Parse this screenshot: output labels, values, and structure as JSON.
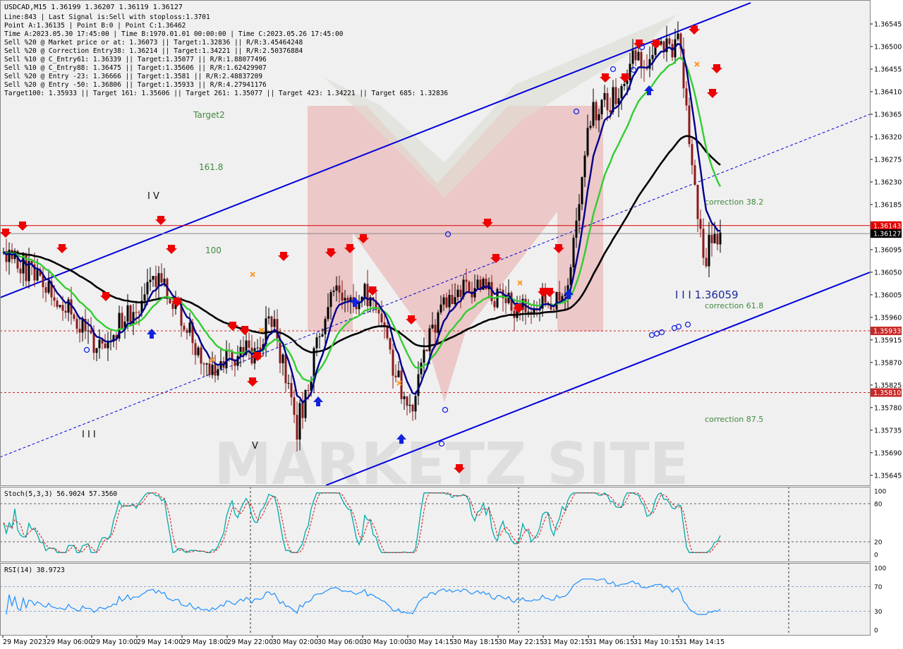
{
  "header": {
    "symbol_line": "USDCAD,M15  1.36199 1.36207 1.36119 1.36127",
    "lines": [
      "Line:843 | Last Signal is:Sell with stoploss:1.3701",
      "Point A:1.36135 | Point B:0 | Point C:1.36462",
      "Time A:2023.05.30 17:45:00 | Time B:1970.01.01 00:00:00 | Time C:2023.05.26 17:45:00",
      "Sell %20 @ Market price or at: 1.36073 || Target:1.32836 || R/R:3.45464248",
      "Sell %20 @ Correction Entry38: 1.36214 || Target:1.34221 || R/R:2.50376884",
      "Sell %10 @ C_Entry61: 1.36339 || Target:1.35077 || R/R:1.88077496",
      "Sell %10 @ C_Entry88: 1.36475 || Target:1.35606 || R/R:1.62429907",
      "Sell %20 @ Entry -23: 1.36666 || Target:1.3581 || R/R:2.48837209",
      "Sell %20 @ Entry -50: 1.36806 || Target:1.35933 || R/R:4.27941176",
      "Target100: 1.35933 || Target 161: 1.35606 || Target 261: 1.35077 || Target 423: 1.34221 || Target 685: 1.32836"
    ]
  },
  "labels": {
    "target2": "Target2",
    "fib1618": "161.8",
    "fib100": "100",
    "wave4": "I V",
    "wave3": "I I I",
    "wave5": "V",
    "wave_level": "I I I 1.36059",
    "corr382": "correction 38.2",
    "corr618": "correction 61.8",
    "corr875": "correction 87.5"
  },
  "watermark": {
    "text": "MARKETZ SITE"
  },
  "price_axis": {
    "ticks": [
      "1.36545",
      "1.36500",
      "1.36455",
      "1.36410",
      "1.36365",
      "1.36320",
      "1.36275",
      "1.36230",
      "1.36185",
      "1.36095",
      "1.36050",
      "1.36005",
      "1.35960",
      "1.35915",
      "1.35870",
      "1.35825",
      "1.35780",
      "1.35735",
      "1.35690",
      "1.35645"
    ],
    "markers": [
      {
        "label": "1.36143",
        "color": "#e00000"
      },
      {
        "label": "1.36127",
        "color": "#000000"
      },
      {
        "label": "1.35933",
        "color": "#c82828"
      },
      {
        "label": "1.35810",
        "color": "#c82828"
      }
    ]
  },
  "time_axis": {
    "labels": [
      "29 May 2023",
      "29 May 06:00",
      "29 May 10:00",
      "29 May 14:00",
      "29 May 18:00",
      "29 May 22:00",
      "30 May 02:00",
      "30 May 06:00",
      "30 May 10:00",
      "30 May 14:15",
      "30 May 18:15",
      "30 May 22:15",
      "31 May 02:15",
      "31 May 06:15",
      "31 May 10:15",
      "31 May 14:15"
    ]
  },
  "stoch": {
    "label": "Stoch(5,3,3) 56.9024 57.3560",
    "levels": [
      "100",
      "80",
      "20",
      "0"
    ]
  },
  "rsi": {
    "label": "RSI(14) 38.9723",
    "levels": [
      "100",
      "70",
      "30",
      "0"
    ]
  },
  "colors": {
    "bull_candle": "#000000",
    "bear_candle": "#8b1a1a",
    "ma_fast": "#00008b",
    "ma_mid": "#32cd32",
    "ma_slow": "#000000",
    "channel": "#0000dd",
    "stoch_main": "#00aaaa",
    "stoch_signal": "#dd2222",
    "rsi": "#1e90ff",
    "sell_arrow": "#ee0000",
    "buy_arrow": "#1122dd",
    "cross": "#ff9922"
  },
  "chart_data": {
    "type": "candlestick",
    "symbol": "USDCAD",
    "timeframe": "M15",
    "last_ohlc": {
      "open": 1.36199,
      "high": 1.36207,
      "low": 1.36119,
      "close": 1.36127
    },
    "y_range": [
      1.35625,
      1.3659
    ],
    "horizontal_levels": [
      1.36143,
      1.36127,
      1.35933,
      1.3581
    ],
    "approx_close_path": [
      {
        "t": "29 May 00:00",
        "p": 1.3609
      },
      {
        "t": "29 May 04:00",
        "p": 1.3603
      },
      {
        "t": "29 May 08:00",
        "p": 1.359
      },
      {
        "t": "29 May 12:00",
        "p": 1.3598
      },
      {
        "t": "29 May 14:00",
        "p": 1.3605
      },
      {
        "t": "29 May 18:00",
        "p": 1.3586
      },
      {
        "t": "29 May 22:00",
        "p": 1.3589
      },
      {
        "t": "30 May 00:00",
        "p": 1.3596
      },
      {
        "t": "30 May 02:00",
        "p": 1.3573
      },
      {
        "t": "30 May 05:00",
        "p": 1.36
      },
      {
        "t": "30 May 09:00",
        "p": 1.36
      },
      {
        "t": "30 May 12:00",
        "p": 1.3576
      },
      {
        "t": "30 May 14:15",
        "p": 1.3595
      },
      {
        "t": "30 May 16:00",
        "p": 1.36
      },
      {
        "t": "30 May 18:15",
        "p": 1.3602
      },
      {
        "t": "30 May 22:15",
        "p": 1.3597
      },
      {
        "t": "31 May 02:15",
        "p": 1.3601
      },
      {
        "t": "31 May 04:00",
        "p": 1.3636
      },
      {
        "t": "31 May 06:15",
        "p": 1.364
      },
      {
        "t": "31 May 08:00",
        "p": 1.3648
      },
      {
        "t": "31 May 10:15",
        "p": 1.3648
      },
      {
        "t": "31 May 12:00",
        "p": 1.3651
      },
      {
        "t": "31 May 14:15",
        "p": 1.3606
      },
      {
        "t": "31 May 15:00",
        "p": 1.3613
      }
    ],
    "stoch_range": [
      0,
      100
    ],
    "rsi_range": [
      0,
      100
    ],
    "stoch_last": {
      "main": 56.9024,
      "signal": 57.356
    },
    "rsi_last": 38.9723
  }
}
